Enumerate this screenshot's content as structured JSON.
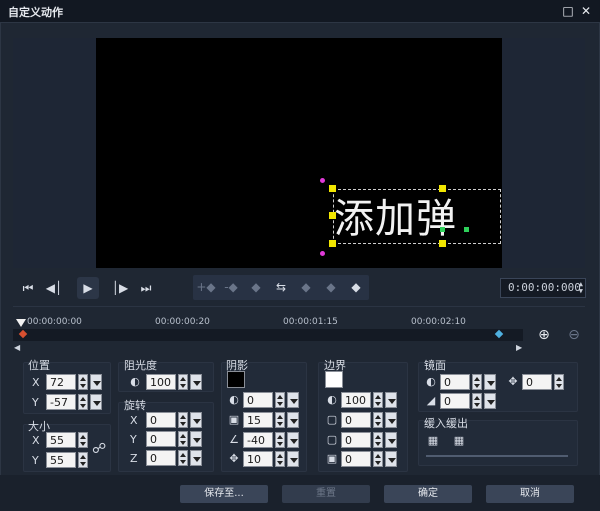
{
  "window": {
    "title": "自定义动作",
    "maximize_icon": "maximize-icon",
    "close_icon": "close-icon"
  },
  "preview": {
    "overlay_text": "添加弹"
  },
  "playback": {
    "buttons": [
      "skip-to-start-icon",
      "prev-frame-icon",
      "play-icon",
      "next-frame-icon",
      "skip-to-end-icon"
    ],
    "timecode": "0:00:00:000"
  },
  "keyframe_tools": [
    "add-keyframe-icon",
    "remove-keyframe-icon",
    "reverse-keyframe-icon",
    "swap-keyframe-icon",
    "prev-keyframe-icon",
    "next-keyframe-icon",
    "more-keyframe-icon"
  ],
  "timeline": {
    "ticks": [
      "00:00:00:00",
      "00:00:00:20",
      "00:00:01:15",
      "00:00:02:10"
    ],
    "zoom_in": "zoom-in-icon",
    "zoom_out": "zoom-out-icon"
  },
  "position": {
    "label": "位置",
    "x_label": "X",
    "x": "72",
    "y_label": "Y",
    "y": "-57"
  },
  "size": {
    "label": "大小",
    "x_label": "X",
    "x": "55",
    "y_label": "Y",
    "y": "55"
  },
  "opacity": {
    "label": "阻光度",
    "value": "100"
  },
  "rotation": {
    "label": "旋转",
    "x_label": "X",
    "x": "0",
    "y_label": "Y",
    "y": "0",
    "z_label": "Z",
    "z": "0"
  },
  "shadow": {
    "label": "阴影",
    "color": "#000000",
    "opacity": "0",
    "blur": "15",
    "angle": "-40",
    "distance": "10"
  },
  "border": {
    "label": "边界",
    "color": "#ffffff",
    "opacity": "100",
    "width": "0",
    "corner": "0",
    "softness": "0"
  },
  "mirror": {
    "label": "镜面",
    "opacity": "0",
    "offset": "0",
    "fade": "0"
  },
  "fade": {
    "label": "缓入缓出"
  },
  "footer": {
    "save_to": "保存至...",
    "reset": "重置",
    "ok": "确定",
    "cancel": "取消"
  }
}
